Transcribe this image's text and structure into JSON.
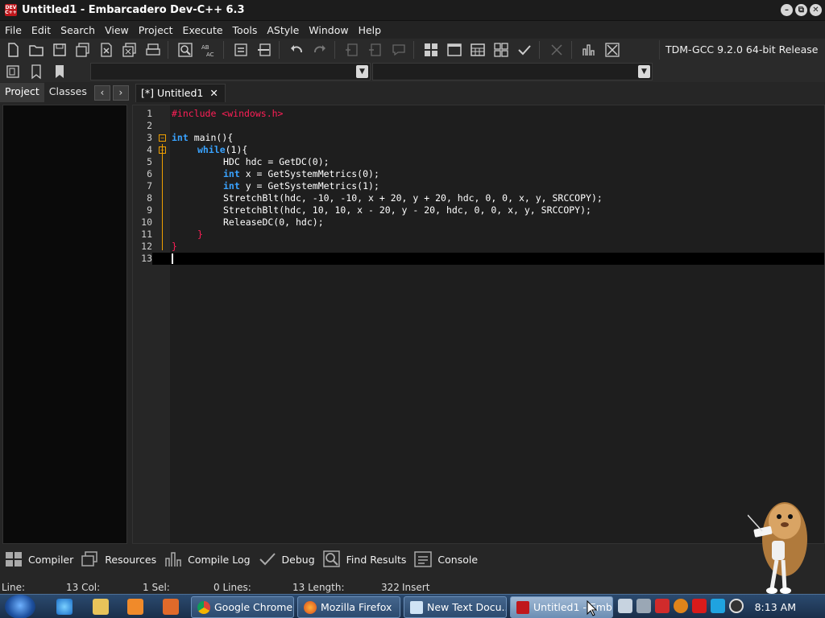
{
  "window": {
    "title": "Untitled1 - Embarcadero Dev-C++ 6.3",
    "app_icon_text": "DEV C++"
  },
  "menu": [
    "File",
    "Edit",
    "Search",
    "View",
    "Project",
    "Execute",
    "Tools",
    "AStyle",
    "Window",
    "Help"
  ],
  "compiler": "TDM-GCC 9.2.0 64-bit Release",
  "left_tabs": {
    "project": "Project",
    "classes": "Classes",
    "prev": "‹",
    "next": "›"
  },
  "editor_tab": {
    "label": "[*] Untitled1",
    "close": "✕"
  },
  "code_lines": [
    "1",
    "2",
    "3",
    "4",
    "5",
    "6",
    "7",
    "8",
    "9",
    "10",
    "11",
    "12",
    "13"
  ],
  "code": {
    "l1": {
      "pp": "#include <windows.h>"
    },
    "l3": {
      "kw": "int",
      "rest": " main(){"
    },
    "l4": {
      "kw": "while",
      "rest": "(1){"
    },
    "l5": "HDC hdc = GetDC(0);",
    "l6": {
      "kw": "int",
      "rest": " x = GetSystemMetrics(0);"
    },
    "l7": {
      "kw": "int",
      "rest": " y = GetSystemMetrics(1);"
    },
    "l8": "StretchBlt(hdc, -10, -10, x + 20, y + 20, hdc, 0, 0, x, y, SRCCOPY);",
    "l9": "StretchBlt(hdc, 10, 10, x - 20, y - 20, hdc, 0, 0, x, y, SRCCOPY);",
    "l10": "ReleaseDC(0, hdc);",
    "l11": "}",
    "l12": "}"
  },
  "bottom_tabs": [
    "Compiler",
    "Resources",
    "Compile Log",
    "Debug",
    "Find Results",
    "Console"
  ],
  "status": {
    "line_label": "Line:",
    "line_value": "13 Col:",
    "col_value": "1 Sel:",
    "sel_value": "0 Lines:",
    "lines_value": "13 Length:",
    "length_value": "322",
    "mode": "Insert"
  },
  "taskbar": {
    "buttons": [
      "Google Chrome",
      "Mozilla Firefox",
      "New Text Docu...",
      "Untitled1 - Emb..."
    ],
    "clock": "8:13 AM"
  },
  "colors": {
    "keyword": "#39a3ff",
    "preprocessor": "#ff1f57",
    "number": "#ff4aa5",
    "fold": "#f0a000"
  }
}
